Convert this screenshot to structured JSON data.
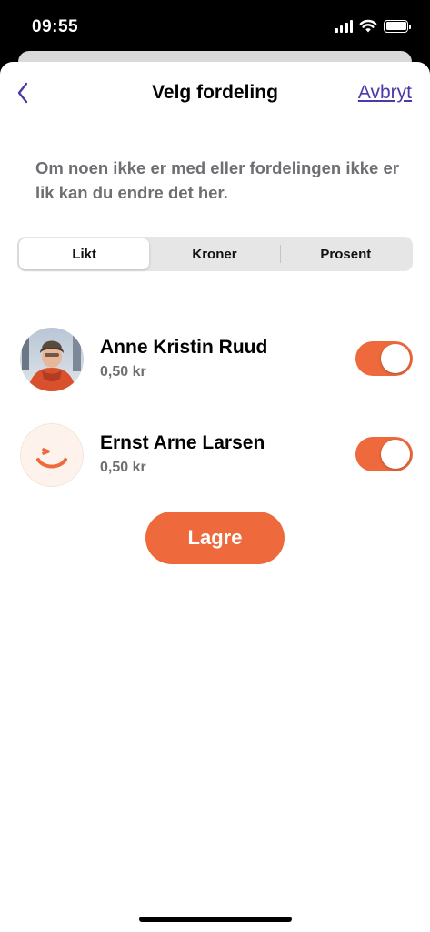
{
  "status_bar": {
    "time": "09:55",
    "icons": [
      "signal-icon",
      "wifi-icon",
      "battery-icon"
    ]
  },
  "nav": {
    "back_icon": "chevron-left-icon",
    "title": "Velg fordeling",
    "cancel_label": "Avbryt"
  },
  "intro_text": "Om noen ikke er med eller fordelingen ikke er lik kan du endre det her.",
  "segmented_control": {
    "selected": "Likt",
    "options": [
      {
        "label": "Likt"
      },
      {
        "label": "Kroner"
      },
      {
        "label": "Prosent"
      }
    ]
  },
  "participants": [
    {
      "name": "Anne Kristin Ruud",
      "amount": "0,50 kr",
      "included": true,
      "avatar": "photo-avatar"
    },
    {
      "name": "Ernst Arne Larsen",
      "amount": "0,50 kr",
      "included": true,
      "avatar": "default-smile-avatar"
    }
  ],
  "save_label": "Lagre",
  "colors": {
    "accent": "#ee6a3c",
    "link": "#4b3aa8",
    "muted_text": "#6e6e73",
    "segment_bg": "#e6e6e6"
  }
}
